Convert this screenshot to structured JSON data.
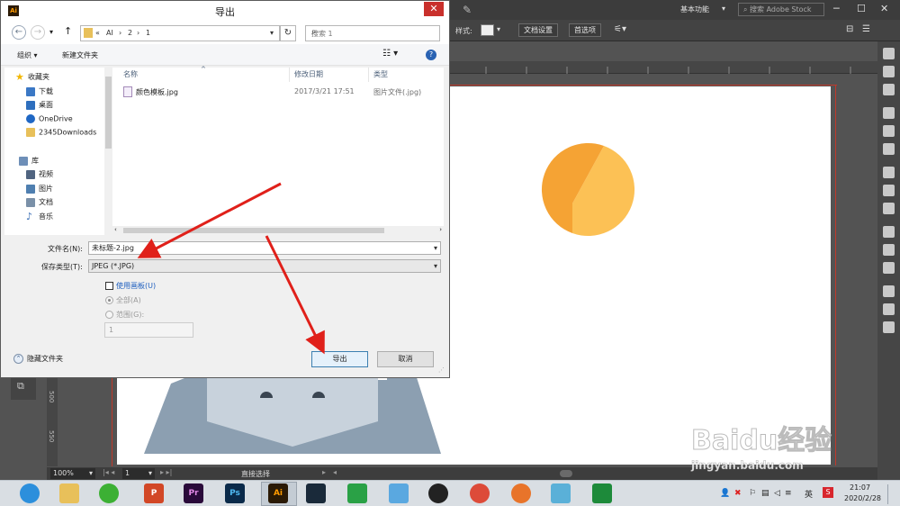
{
  "dialog": {
    "title": "导出",
    "app_icon_text": "Ai",
    "close_glyph": "✕",
    "address": {
      "segments": [
        "«",
        "AI",
        "›",
        "2",
        "›",
        "1"
      ],
      "search_placeholder": "搜索 1"
    },
    "toolbar": {
      "organize_label": "组织 ▾",
      "new_folder_label": "新建文件夹"
    },
    "nav": {
      "items": [
        {
          "label": "收藏夹",
          "icon": "star-icon",
          "color": "#f2b705"
        },
        {
          "label": "下载",
          "icon": "download-folder-icon",
          "color": "#3b78c5"
        },
        {
          "label": "桌面",
          "icon": "desktop-icon",
          "color": "#2e6fbe"
        },
        {
          "label": "OneDrive",
          "icon": "onedrive-icon",
          "color": "#1f67c4"
        },
        {
          "label": "2345Downloads",
          "icon": "folder-icon",
          "color": "#e8c05a"
        },
        {
          "label": "库",
          "icon": "library-icon",
          "color": "#6e8fb8"
        },
        {
          "label": "视频",
          "icon": "video-icon",
          "color": "#506480"
        },
        {
          "label": "图片",
          "icon": "pictures-icon",
          "color": "#4f7fb0"
        },
        {
          "label": "文档",
          "icon": "documents-icon",
          "color": "#7a90a8"
        },
        {
          "label": "音乐",
          "icon": "music-icon",
          "color": "#3a6fb5"
        }
      ]
    },
    "files": {
      "columns": [
        "名称",
        "修改日期",
        "类型"
      ],
      "rows": [
        {
          "name": "颜色模板.jpg",
          "modified": "2017/3/21 17:51",
          "type": "图片文件(.jpg)"
        }
      ]
    },
    "filename_label": "文件名(N):",
    "filename_value": "未标题-2.jpg",
    "filetype_label": "保存类型(T):",
    "filetype_value": "JPEG (*.JPG)",
    "options": {
      "use_artboards": "使用画板(U)",
      "all": "全部(A)",
      "range": "范围(G):",
      "range_value": "1"
    },
    "hide_folders": "隐藏文件夹",
    "export_button": "导出",
    "cancel_button": "取消"
  },
  "illustrator": {
    "workspace": "基本功能",
    "stock_search": "搜索 Adobe Stock",
    "style_label": "样式:",
    "document_setup": "文档设置",
    "preferences": "首选项",
    "zoom": "100%",
    "artboard_number": "1",
    "status_tool": "直接选择",
    "ruler_left_marks": [
      "500",
      "550"
    ],
    "colors": {
      "shape_orange_light": "#fcc155",
      "shape_orange_dark": "#f5a334",
      "bg_shape": "#8c9fb1",
      "bg_shape_light": "#c8d2dc",
      "bg_shape_dots": "#3a4551"
    }
  },
  "taskbar": {
    "apps": [
      {
        "name": "browser-360",
        "color": "#2c8fdc",
        "text": ""
      },
      {
        "name": "file-explorer",
        "color": "#e8c05a",
        "text": ""
      },
      {
        "name": "wechat",
        "color": "#3cb034",
        "text": ""
      },
      {
        "name": "powerpoint",
        "color": "#d24726",
        "text": "P"
      },
      {
        "name": "premiere",
        "color": "#2a0a3a",
        "text": "Pr"
      },
      {
        "name": "photoshop",
        "color": "#0a2a4a",
        "text": "Ps"
      },
      {
        "name": "illustrator",
        "color": "#2b1a05",
        "text": "Ai"
      },
      {
        "name": "video-editor",
        "color": "#1a2a3a",
        "text": ""
      },
      {
        "name": "screen-capture",
        "color": "#2aa146",
        "text": ""
      },
      {
        "name": "bird-app",
        "color": "#5aa8e0",
        "text": ""
      },
      {
        "name": "qq",
        "color": "#222222",
        "text": ""
      },
      {
        "name": "chrome",
        "color": "#dd4b39",
        "text": ""
      },
      {
        "name": "firefox-like",
        "color": "#e8742a",
        "text": ""
      },
      {
        "name": "notes-app",
        "color": "#5ab0d8",
        "text": ""
      },
      {
        "name": "green-app",
        "color": "#1d8a3a",
        "text": ""
      }
    ],
    "time": "21:07",
    "date": "2020/2/28"
  },
  "watermark": {
    "brand": "Baidu经验",
    "url": "jingyan.baidu.com"
  }
}
